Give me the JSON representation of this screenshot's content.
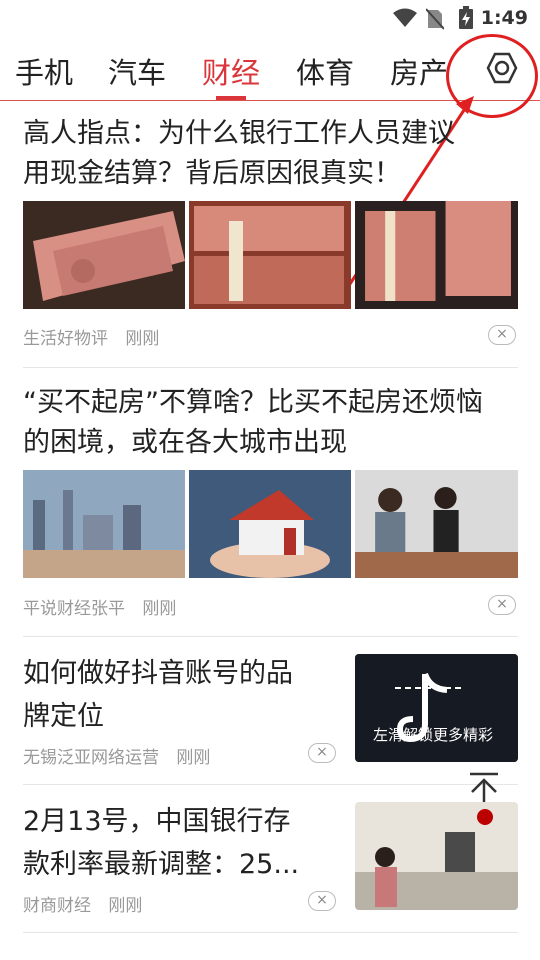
{
  "status_bar": {
    "time": "1:49"
  },
  "tabs": [
    {
      "label": "手机"
    },
    {
      "label": "汽车"
    },
    {
      "label": "财经"
    },
    {
      "label": "体育"
    },
    {
      "label": "房产"
    }
  ],
  "articles": [
    {
      "title_line1": "高人指点：为什么银行工作人员建议",
      "title_line2": "用现金结算？背后原因很真实！",
      "source": "生活好物评",
      "time": "刚刚"
    },
    {
      "title_line1": "“买不起房”不算啥？比买不起房还烦恼",
      "title_line2": "的困境，或在各大城市出现",
      "source": "平说财经张平",
      "time": "刚刚"
    },
    {
      "title_line1": "如何做好抖音账号的品",
      "title_line2": "牌定位",
      "source": "无锡泛亚网络运营",
      "time": "刚刚",
      "thumb_caption": "左滑解锁更多精彩"
    },
    {
      "title_line1": "2月13号，中国银行存",
      "title_line2": "款利率最新调整：25...",
      "source": "财商财经",
      "time": "刚刚"
    }
  ],
  "icons": {
    "settings": "hexagon-settings-icon",
    "dismiss": "close-icon",
    "scroll_top": "arrow-up-icon"
  },
  "colors": {
    "accent": "#d9353a",
    "annotation": "#e02020"
  }
}
